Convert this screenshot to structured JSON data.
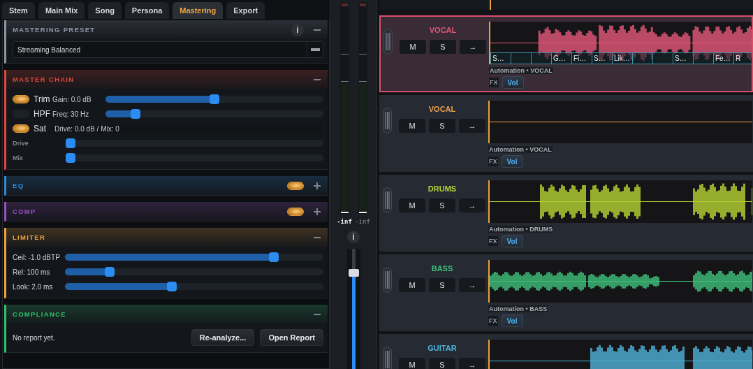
{
  "tabs": [
    {
      "label": "Stem",
      "selected": false
    },
    {
      "label": "Main Mix",
      "selected": false
    },
    {
      "label": "Song",
      "selected": false
    },
    {
      "label": "Persona",
      "selected": false
    },
    {
      "label": "Mastering",
      "selected": true
    },
    {
      "label": "Export",
      "selected": false
    }
  ],
  "sections": [
    {
      "kind": "preset",
      "title": "MASTERING PRESET",
      "color": "#8a96a6",
      "expanded": true,
      "info": "i",
      "value": "Streaming Balanced"
    },
    {
      "kind": "chain",
      "title": "MASTER CHAIN",
      "color": "#e0463a",
      "expanded": true,
      "rows": [
        {
          "kind": "toggle_slider",
          "on": true,
          "label": "Trim",
          "reading": "Gain: 0.0 dB",
          "level": 0.5
        },
        {
          "kind": "toggle_slider",
          "on": false,
          "label": "HPF",
          "reading": "Freq: 30 Hz",
          "level": 0.12
        },
        {
          "kind": "toggle_reading",
          "on": true,
          "label": "Sat",
          "reading": "Drive: 0.0 dB / Mix: 0"
        },
        {
          "kind": "slider",
          "label": "Drive",
          "level": 0
        },
        {
          "kind": "slider",
          "label": "Mix",
          "level": 0
        }
      ]
    },
    {
      "kind": "module",
      "title": "EQ",
      "color": "#2e8ad6",
      "expanded": false,
      "on": true
    },
    {
      "kind": "module",
      "title": "COMP",
      "color": "#9b4fc4",
      "expanded": false,
      "on": true
    },
    {
      "kind": "limiter",
      "title": "LIMITER",
      "color": "#eda23f",
      "expanded": true,
      "rows": [
        {
          "label": "Ceil: -1.0 dBTP",
          "level": 0.82
        },
        {
          "label": "Rel: 100 ms",
          "level": 0.16
        },
        {
          "label": "Look: 2.0 ms",
          "level": 0.41
        }
      ]
    },
    {
      "kind": "compliance",
      "title": "COMPLIANCE",
      "color": "#2ec46e",
      "expanded": true,
      "message": "No report yet.",
      "buttons": [
        "Re-analyze...",
        "Open Report"
      ]
    }
  ],
  "meters": {
    "channels": [
      {
        "reading": "-inf",
        "level": 0,
        "highlighted": true
      },
      {
        "reading": "-inf",
        "level": 0,
        "highlighted": false
      }
    ],
    "info": "i",
    "fader": {
      "level": 0.82
    }
  },
  "tracks": [
    {
      "name": "VOCAL",
      "color": "#e4587a",
      "selected": true,
      "buttons": [
        "M",
        "S",
        "→"
      ],
      "automation": "Automation • VOCAL",
      "fx": "FX",
      "vol": "Vol",
      "lyrics": [
        {
          "kind": "lyric",
          "label": "S…"
        },
        {
          "kind": "blank"
        },
        {
          "kind": "blank"
        },
        {
          "kind": "lyric",
          "label": "G…"
        },
        {
          "kind": "lyric",
          "label": "Fi…"
        },
        {
          "kind": "lyric",
          "label": "S…"
        },
        {
          "kind": "lyric",
          "label": "Lik…"
        },
        {
          "kind": "blank"
        },
        {
          "kind": "blank"
        },
        {
          "kind": "lyric",
          "label": "S…"
        },
        {
          "kind": "blank"
        },
        {
          "kind": "lyric",
          "label": "Fe…"
        },
        {
          "kind": "lyric",
          "label": "R"
        }
      ]
    },
    {
      "name": "VOCAL",
      "color": "#eda04a",
      "selected": false,
      "buttons": [
        "M",
        "S",
        "→"
      ],
      "automation": "Automation • VOCAL",
      "fx": "FX",
      "vol": "Vol"
    },
    {
      "name": "DRUMS",
      "color": "#b6d334",
      "selected": false,
      "buttons": [
        "M",
        "S",
        "→"
      ],
      "automation": "Automation • DRUMS",
      "fx": "FX",
      "vol": "Vol"
    },
    {
      "name": "BASS",
      "color": "#3fbf7a",
      "selected": false,
      "buttons": [
        "M",
        "S",
        "→"
      ],
      "automation": "Automation • BASS",
      "fx": "FX",
      "vol": "Vol"
    },
    {
      "name": "GUITAR",
      "color": "#4fb2da",
      "selected": false,
      "buttons": [
        "M",
        "S",
        "→"
      ]
    }
  ]
}
